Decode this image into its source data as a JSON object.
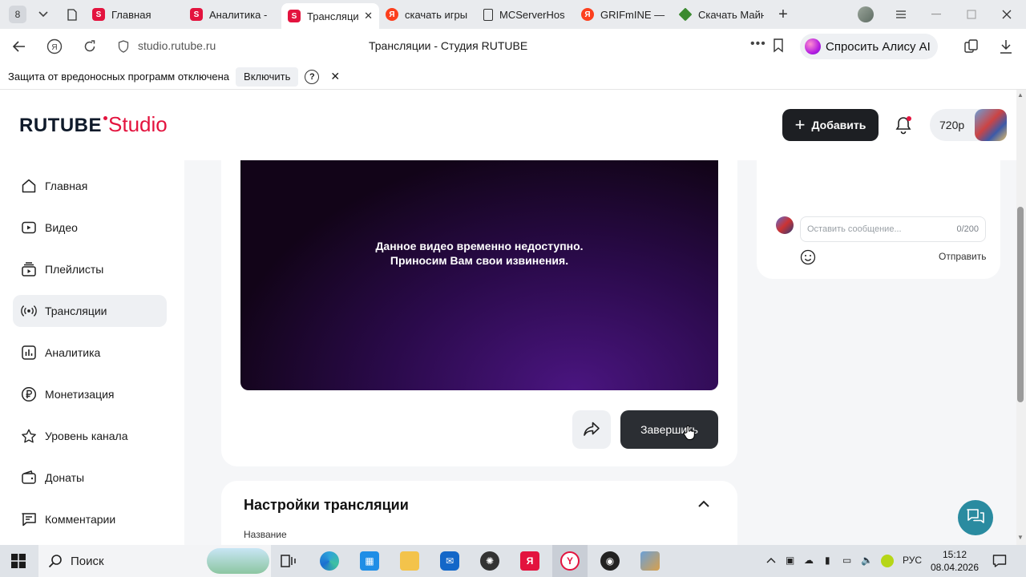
{
  "browser": {
    "tab_count": "8",
    "tabs": [
      {
        "label": "Главная",
        "icon": "rutube"
      },
      {
        "label": "Аналитика - ",
        "icon": "rutube"
      },
      {
        "label": "Трансляци",
        "icon": "rutube",
        "active": true
      },
      {
        "label": "скачать игры",
        "icon": "yandex"
      },
      {
        "label": "MCServerHos",
        "icon": "doc"
      },
      {
        "label": "GRIFmINE —",
        "icon": "yandex"
      },
      {
        "label": "Скачать Майн",
        "icon": "minecraft"
      }
    ],
    "url": "studio.rutube.ru",
    "page_title": "Трансляции - Студия RUTUBE",
    "alice_label": "Спросить Алису AI"
  },
  "notification": {
    "text": "Защита от вредоносных программ отключена",
    "enable_label": "Включить",
    "help": "?"
  },
  "header": {
    "logo_brand": "RUTUBE",
    "logo_product": "Studio",
    "add_label": "Добавить",
    "quality": "720p"
  },
  "sidebar": {
    "items": [
      {
        "label": "Главная",
        "icon": "home-icon"
      },
      {
        "label": "Видео",
        "icon": "play-icon"
      },
      {
        "label": "Плейлисты",
        "icon": "playlist-icon"
      },
      {
        "label": "Трансляции",
        "icon": "broadcast-icon",
        "active": true
      },
      {
        "label": "Аналитика",
        "icon": "chart-icon"
      },
      {
        "label": "Монетизация",
        "icon": "ruble-icon"
      },
      {
        "label": "Уровень канала",
        "icon": "star-icon"
      },
      {
        "label": "Донаты",
        "icon": "wallet-icon"
      },
      {
        "label": "Комментарии",
        "icon": "comment-icon"
      }
    ]
  },
  "player": {
    "message_line1": "Данное видео временно недоступно.",
    "message_line2": "Приносим Вам свои извинения."
  },
  "actions": {
    "finish_label": "Завершить"
  },
  "chat": {
    "placeholder": "Оставить сообщение...",
    "counter": "0/200",
    "send_label": "Отправить"
  },
  "settings": {
    "title": "Настройки трансляции",
    "field_label": "Название"
  },
  "taskbar": {
    "search_label": "Поиск",
    "lang": "РУС",
    "time": "15:12",
    "date": "08.04.2026"
  },
  "colors": {
    "brand_red": "#e3133e",
    "dark_button": "#1d1f23",
    "sidebar_active": "#eef0f3",
    "support_teal": "#2a8ba0"
  }
}
